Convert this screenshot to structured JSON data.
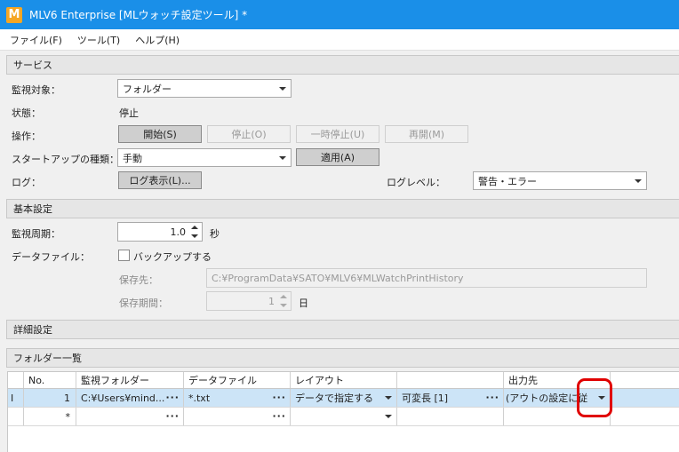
{
  "window": {
    "title": "MLV6 Enterprise [MLウォッチ設定ツール] *",
    "logo_letter": "M"
  },
  "menu": [
    "ファイル(F)",
    "ツール(T)",
    "ヘルプ(H)"
  ],
  "service": {
    "header": "サービス",
    "target_label": "監視対象：",
    "target_value": "フォルダー",
    "status_label": "状態：",
    "status_value": "停止",
    "operation_label": "操作：",
    "btn_start": "開始(S)",
    "btn_stop": "停止(O)",
    "btn_pause": "一時停止(U)",
    "btn_resume": "再開(M)",
    "startup_label": "スタートアップの種類：",
    "startup_value": "手動",
    "btn_apply": "適用(A)",
    "log_label": "ログ：",
    "btn_log": "ログ表示(L)...",
    "loglevel_label": "ログレベル：",
    "loglevel_value": "警告・エラー"
  },
  "basic": {
    "header": "基本設定",
    "interval_label": "監視周期：",
    "interval_value": "1.0",
    "interval_unit": "秒",
    "datafile_label": "データファイル：",
    "backup_label": "バックアップする",
    "save_to_label": "保存先：",
    "save_to_value": "C:¥ProgramData¥SATO¥MLV6¥MLWatchPrintHistory",
    "save_period_label": "保存期間：",
    "save_period_value": "1",
    "save_period_unit": "日"
  },
  "detail": {
    "header": "詳細設定"
  },
  "folders": {
    "header": "フォルダー一覧",
    "columns": [
      "No.",
      "監視フォルダー",
      "データファイル",
      "レイアウト",
      "",
      "出力先"
    ],
    "rows": [
      {
        "marker": "I",
        "no": "1",
        "folder": "C:¥Users¥mind...",
        "datafile": "*.txt",
        "layout": "データで指定する",
        "extra": "可変長 [1]",
        "output": "(アウトの設定に従う)"
      },
      {
        "marker": "",
        "no": "*",
        "folder": "",
        "datafile": "",
        "layout": "",
        "extra": "",
        "output": ""
      }
    ]
  }
}
